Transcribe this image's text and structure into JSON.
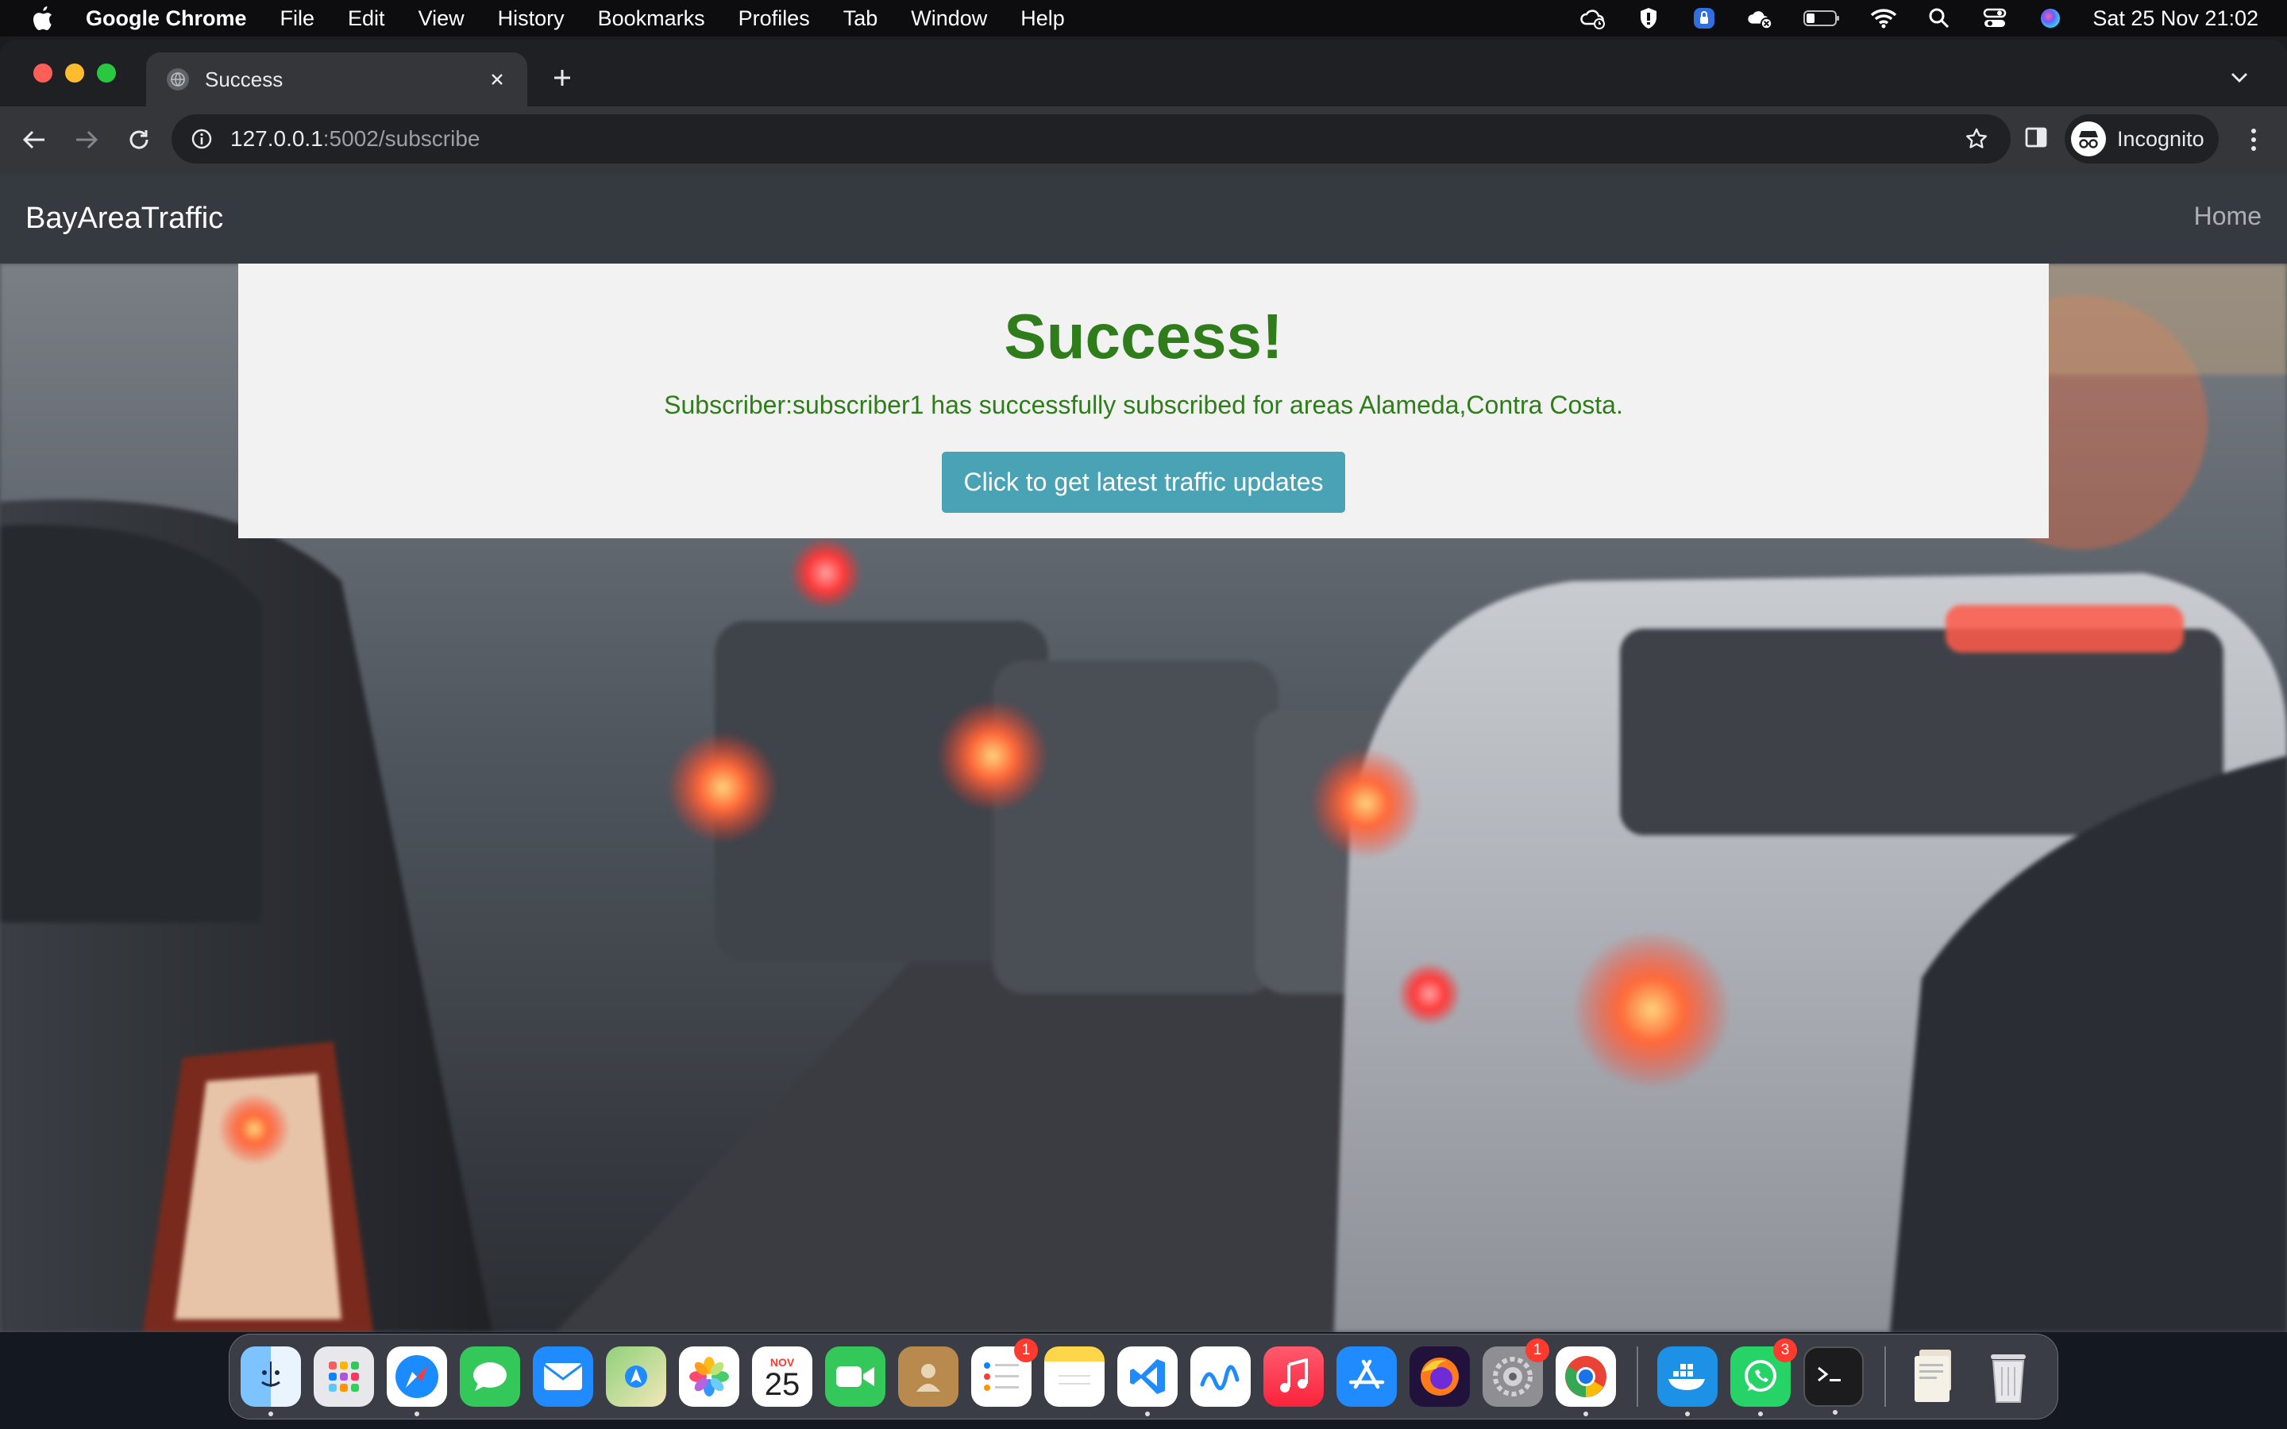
{
  "menubar": {
    "app_name": "Google Chrome",
    "items": [
      "File",
      "Edit",
      "View",
      "History",
      "Bookmarks",
      "Profiles",
      "Tab",
      "Window",
      "Help"
    ],
    "clock": "Sat 25 Nov  21:02"
  },
  "browser": {
    "tab_title": "Success",
    "url_host": "127.0.0.1",
    "url_rest": ":5002/subscribe",
    "profile_label": "Incognito"
  },
  "site": {
    "brand": "BayAreaTraffic",
    "nav_home": "Home"
  },
  "card": {
    "heading": "Success!",
    "message": "Subscriber:subscriber1 has successfully subscribed for areas Alameda,Contra Costa.",
    "button_label": "Click to get latest traffic updates"
  },
  "dock": {
    "calendar_month": "NOV",
    "calendar_day": "25",
    "badges": {
      "reminders": "1",
      "system_settings": "1",
      "whatsapp": "3"
    }
  },
  "colors": {
    "success_green": "#2e7d1a",
    "button_teal": "#4aa3b5",
    "navbar": "#343a40"
  }
}
